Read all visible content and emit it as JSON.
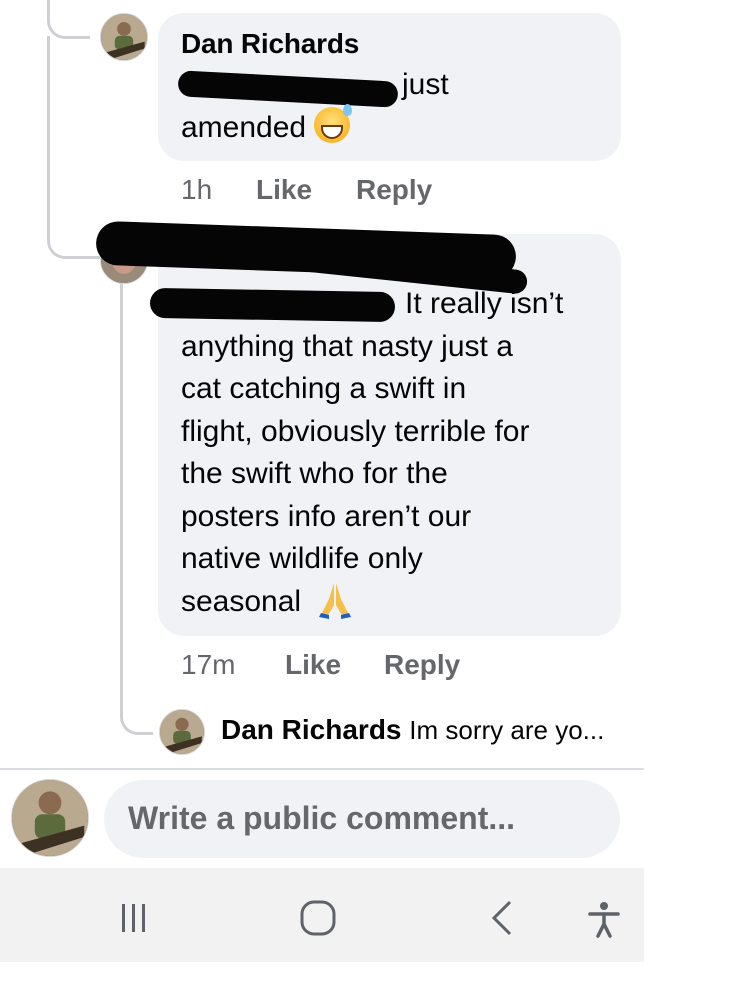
{
  "comments": [
    {
      "author": "Dan Richards",
      "text_line1": "just",
      "text_line2": "amended",
      "emoji": "grinning-sweat-emoji",
      "time": "1h",
      "like_label": "Like",
      "reply_label": "Reply"
    },
    {
      "author": "",
      "text_lines": [
        "It really isn’t",
        "anything that nasty just a",
        "cat catching a swift in",
        "flight, obviously terrible for",
        "the swift who for the",
        "posters info aren’t our",
        "native wildlife only",
        "seasonal"
      ],
      "emoji": "folded-hands-emoji",
      "time": "17m",
      "like_label": "Like",
      "reply_label": "Reply"
    }
  ],
  "reply_preview": {
    "author": "Dan Richards",
    "text": "Im sorry are yo..."
  },
  "composer": {
    "placeholder": "Write a public comment..."
  },
  "navbar": {
    "icons": [
      "recent-apps-icon",
      "home-icon",
      "back-icon",
      "accessibility-icon"
    ]
  },
  "colors": {
    "bubble": "#f0f2f5",
    "mention": "#1b74e4",
    "meta": "#65676b",
    "navbar": "#f2f2f2"
  }
}
